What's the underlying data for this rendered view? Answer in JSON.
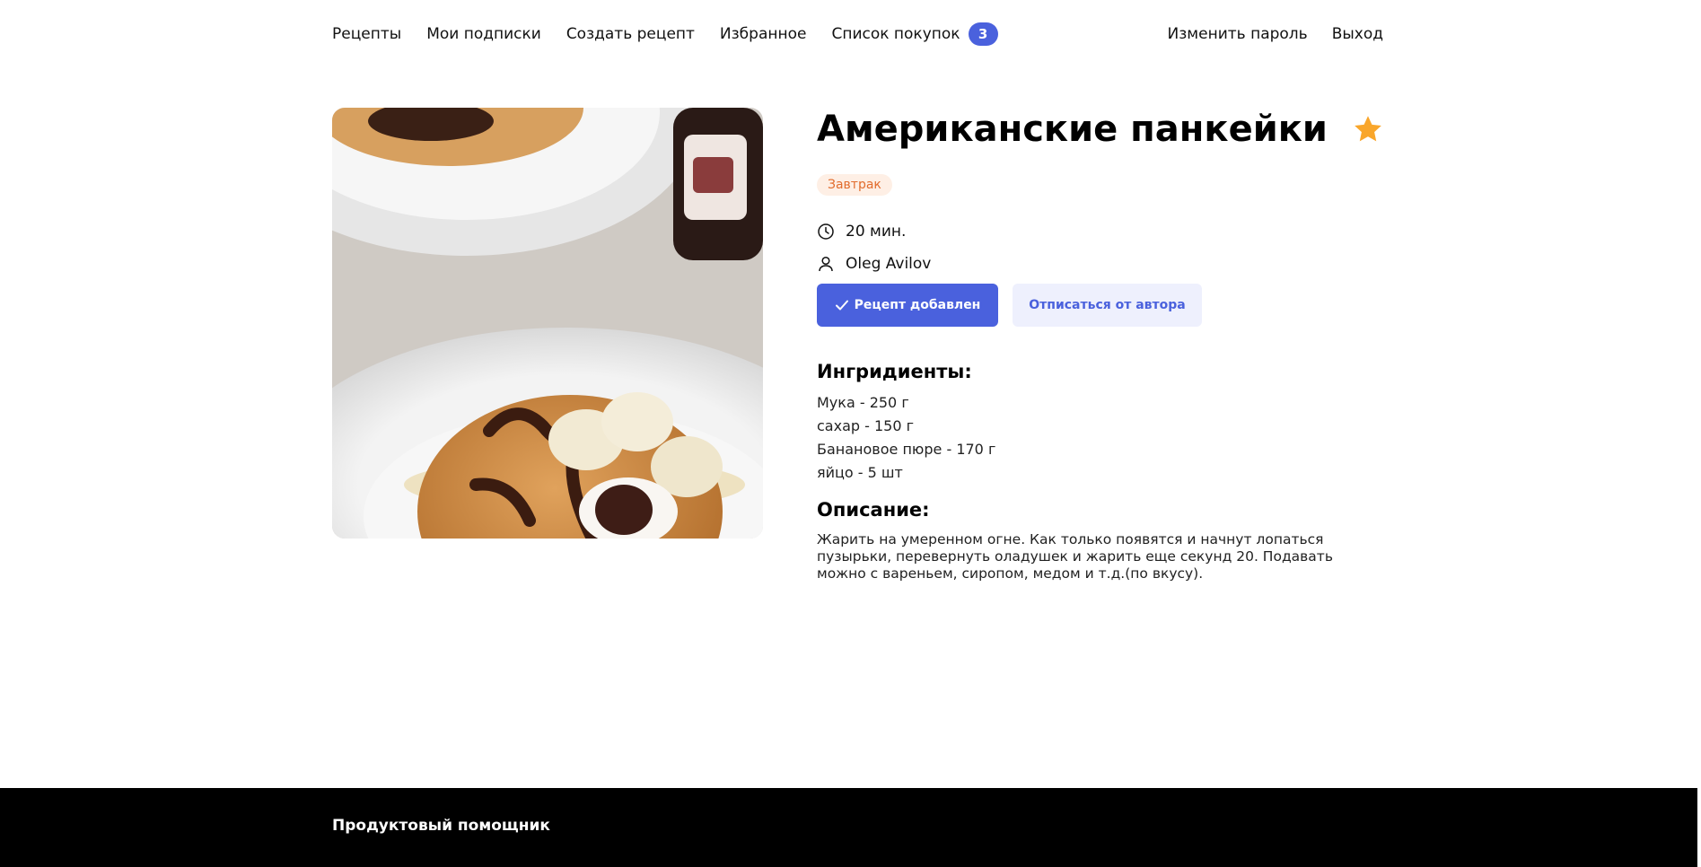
{
  "nav": {
    "links": [
      "Рецепты",
      "Мои подписки",
      "Создать рецепт",
      "Избранное"
    ],
    "cart_label": "Список покупок",
    "cart_count": "3",
    "change_password": "Изменить пароль",
    "logout": "Выход"
  },
  "recipe": {
    "title": "Американские панкейки",
    "tag": "Завтрак",
    "time": "20 мин.",
    "author": "Oleg Avilov",
    "favorite": true,
    "added_button": "Рецепт добавлен",
    "unsubscribe_button": "Отписаться от автора",
    "ingredients_title": "Ингридиенты:",
    "ingredients": [
      "Мука - 250 г",
      "сахар - 150 г",
      "Банановое пюре - 170 г",
      "яйцо - 5 шт"
    ],
    "description_title": "Описание:",
    "description": "Жарить на умеренном огне. Как только появятся и начнут лопаться пузырьки, перевернуть оладушек и жарить еще секунд 20. Подавать можно с вареньем, сиропом, медом и т.д.(по вкусу)."
  },
  "footer": {
    "brand": "Продуктовый помощник"
  },
  "colors": {
    "accent": "#4a61dd",
    "star": "#f9a62b",
    "tag_bg": "#feefe5",
    "tag_text": "#e26c2d",
    "footer_bg": "#000000"
  },
  "icons": {
    "star": "star-icon",
    "clock": "clock-icon",
    "user": "user-icon",
    "check": "check-icon"
  }
}
